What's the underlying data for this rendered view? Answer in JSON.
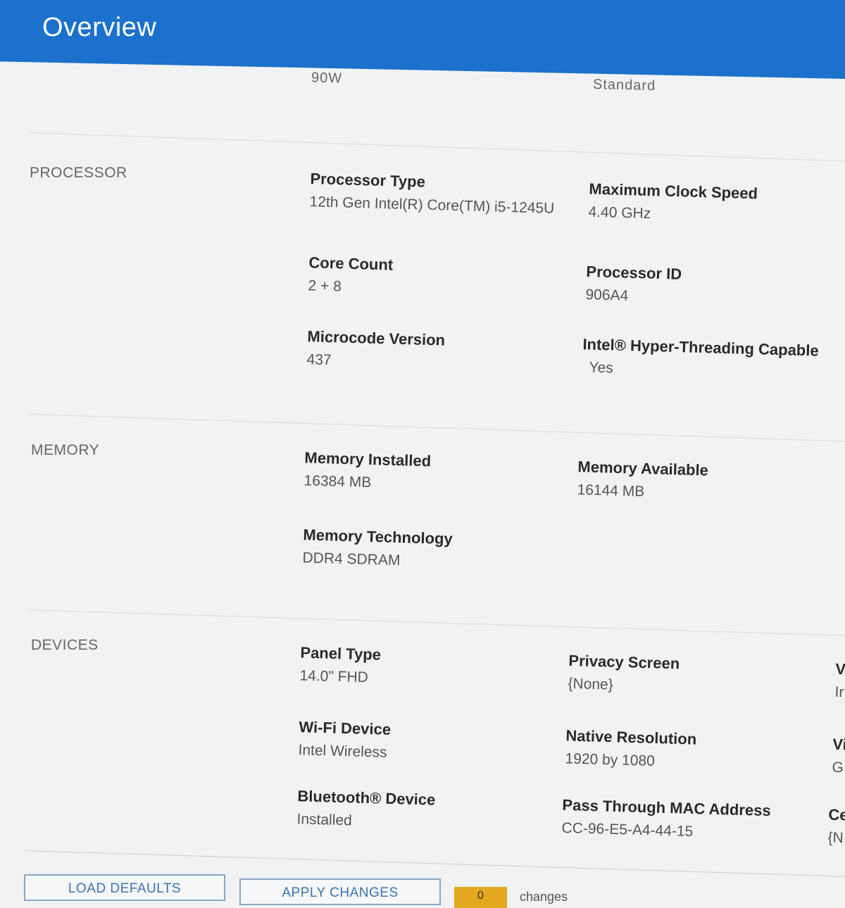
{
  "header": {
    "title": "Overview"
  },
  "top_cutoff": {
    "left_value": "90W",
    "right_value": "Standard"
  },
  "sections": {
    "processor": {
      "label": "PROCESSOR",
      "processor_type": {
        "label": "Processor Type",
        "value": "12th Gen Intel(R) Core(TM) i5-1245U"
      },
      "max_clock_speed": {
        "label": "Maximum Clock Speed",
        "value": "4.40 GHz"
      },
      "core_count": {
        "label": "Core Count",
        "value": "2 + 8"
      },
      "processor_id": {
        "label": "Processor ID",
        "value": "906A4"
      },
      "microcode_version": {
        "label": "Microcode Version",
        "value": "437"
      },
      "hyper_threading": {
        "label": "Intel® Hyper-Threading Capable",
        "value": "Yes"
      }
    },
    "memory": {
      "label": "MEMORY",
      "installed": {
        "label": "Memory Installed",
        "value": "16384 MB"
      },
      "available": {
        "label": "Memory Available",
        "value": "16144 MB"
      },
      "technology": {
        "label": "Memory Technology",
        "value": "DDR4 SDRAM"
      }
    },
    "devices": {
      "label": "DEVICES",
      "panel_type": {
        "label": "Panel Type",
        "value": "14.0\" FHD"
      },
      "privacy_screen": {
        "label": "Privacy Screen",
        "value": "{None}"
      },
      "wifi_device": {
        "label": "Wi-Fi Device",
        "value": "Intel Wireless"
      },
      "native_resolution": {
        "label": "Native Resolution",
        "value": "1920 by 1080"
      },
      "bluetooth_device": {
        "label": "Bluetooth® Device",
        "value": "Installed"
      },
      "pass_through_mac": {
        "label": "Pass Through MAC Address",
        "value": "CC-96-E5-A4-44-15"
      },
      "cutoff_col": [
        {
          "label": "V",
          "value": "Ir"
        },
        {
          "label": "Vi",
          "value": "G"
        },
        {
          "label": "Ce",
          "value": "{N"
        }
      ]
    }
  },
  "footer": {
    "load_defaults": "LOAD DEFAULTS",
    "apply_changes": "APPLY CHANGES",
    "changes_count": "0",
    "changes_text": "changes"
  },
  "colors": {
    "header_bg": "#1b71cc",
    "badge_bg": "#e3a81f",
    "button_text": "#3b74b0"
  }
}
